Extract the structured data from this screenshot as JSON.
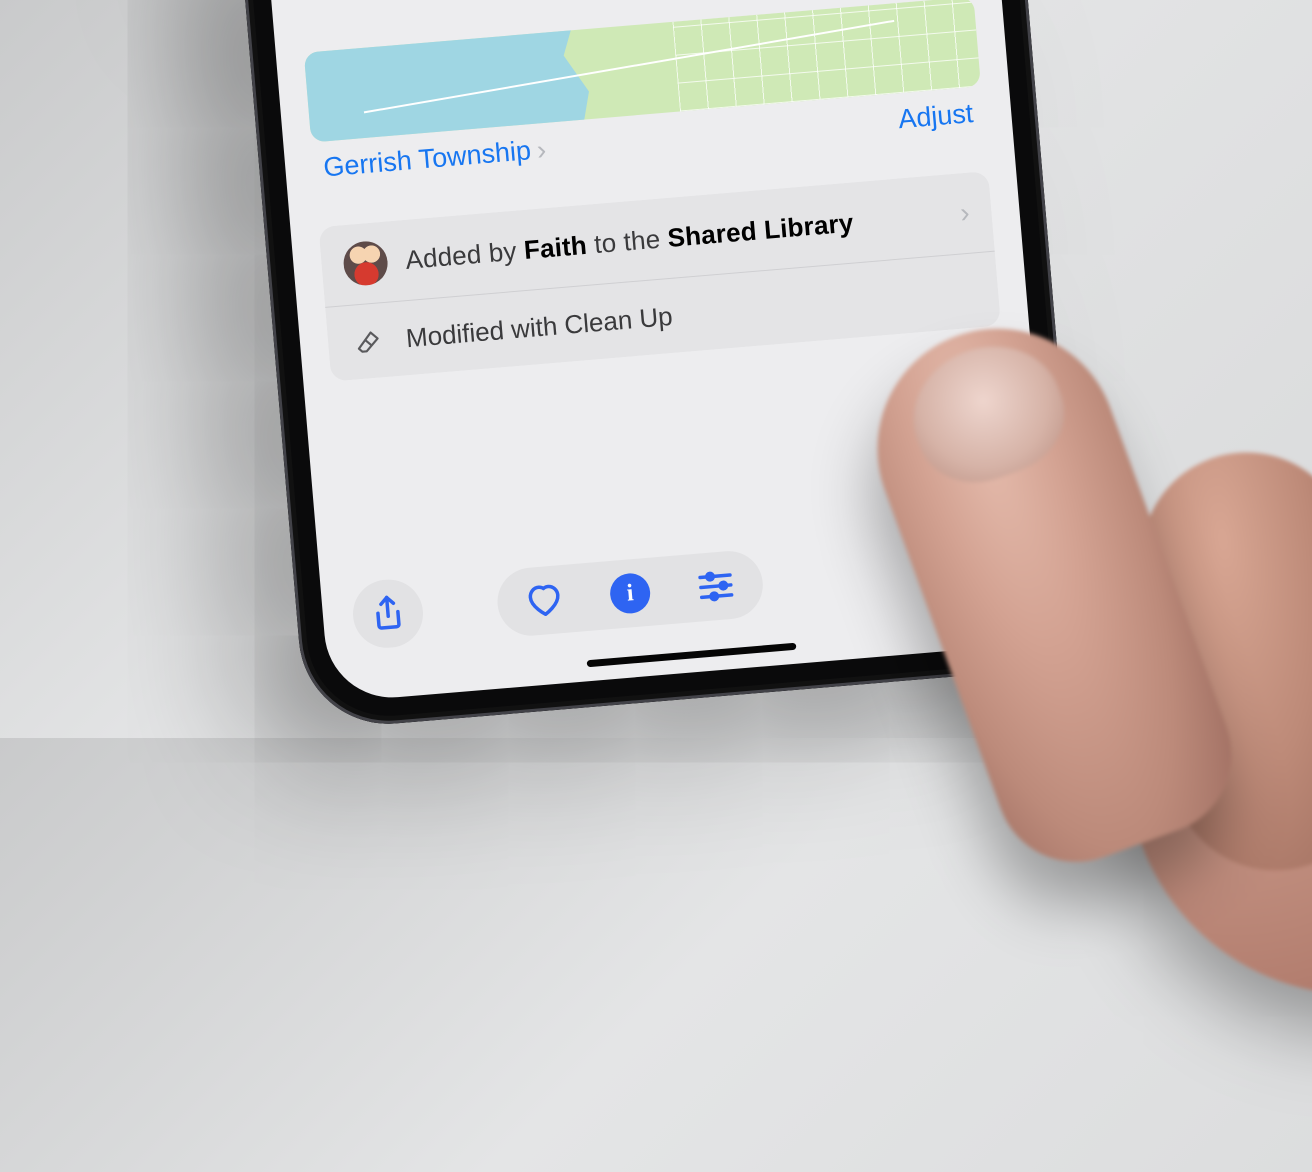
{
  "location": {
    "place_name": "Gerrish Township",
    "adjust_label": "Adjust"
  },
  "shared_info": {
    "prefix": "Added by ",
    "user": "Faith",
    "middle": " to the ",
    "library": "Shared Library"
  },
  "modification": {
    "label": "Modified with Clean Up"
  },
  "toolbar": {
    "share_icon": "share-icon",
    "favorite_icon": "heart-icon",
    "info_icon": "info-icon",
    "adjust_icon": "sliders-icon"
  }
}
